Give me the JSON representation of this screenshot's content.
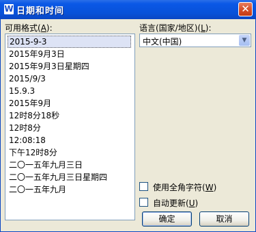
{
  "window": {
    "title": "日期和时间",
    "app_icon_glyph": "W",
    "close_glyph": "✕"
  },
  "formats": {
    "label": "可用格式",
    "accel": "A",
    "items": [
      "2015-9-3",
      "2015年9月3日",
      "2015年9月3日星期四",
      "2015/9/3",
      "15.9.3",
      "2015年9月",
      "12时8分18秒",
      "12时8分",
      "12:08:18",
      "下午12时8分",
      "二〇一五年九月三日",
      "二〇一五年九月三日星期四",
      "二〇一五年九月"
    ],
    "selected_index": 0
  },
  "language": {
    "label": "语言(国家/地区)",
    "accel": "L",
    "selected": "中文(中国)"
  },
  "options": {
    "fullwidth_label": "使用全角字符",
    "fullwidth_accel": "W",
    "fullwidth_checked": false,
    "autoupdate_label": "自动更新",
    "autoupdate_accel": "U",
    "autoupdate_checked": false
  },
  "buttons": {
    "ok": "确定",
    "cancel": "取消"
  },
  "colors": {
    "titlebar": "#0a58e6",
    "selection": "#dde3f5",
    "dialog_bg": "#ece9d8"
  }
}
